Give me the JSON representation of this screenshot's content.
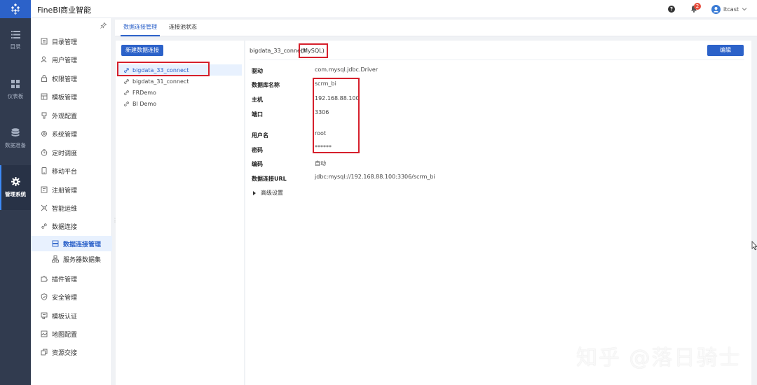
{
  "app": {
    "title": "FineBI商业智能"
  },
  "header": {
    "notification_count": "2",
    "username": "itcast"
  },
  "left_nav": [
    {
      "label": "目录",
      "icon": "list-icon"
    },
    {
      "label": "仪表板",
      "icon": "dashboard-icon"
    },
    {
      "label": "数据准备",
      "icon": "database-icon"
    },
    {
      "label": "管理系统",
      "icon": "gear-icon",
      "active": true
    }
  ],
  "menu": {
    "items": [
      {
        "label": "目录管理",
        "icon": "catalog-icon"
      },
      {
        "label": "用户管理",
        "icon": "user-icon"
      },
      {
        "label": "权限管理",
        "icon": "lock-icon"
      },
      {
        "label": "模板管理",
        "icon": "template-icon"
      },
      {
        "label": "外观配置",
        "icon": "appearance-icon"
      },
      {
        "label": "系统管理",
        "icon": "settings-icon"
      },
      {
        "label": "定时调度",
        "icon": "clock-icon"
      },
      {
        "label": "移动平台",
        "icon": "mobile-icon"
      },
      {
        "label": "注册管理",
        "icon": "register-icon"
      },
      {
        "label": "智能运维",
        "icon": "ops-icon"
      },
      {
        "label": "数据连接",
        "icon": "link-icon"
      },
      {
        "label": "数据连接管理",
        "icon": "connection-manage-icon",
        "sub": true,
        "active": true
      },
      {
        "label": "服务器数据集",
        "icon": "server-dataset-icon",
        "sub": true
      },
      {
        "label": "插件管理",
        "icon": "plugin-icon"
      },
      {
        "label": "安全管理",
        "icon": "shield-icon"
      },
      {
        "label": "模板认证",
        "icon": "certificate-icon"
      },
      {
        "label": "地图配置",
        "icon": "map-icon"
      },
      {
        "label": "资源交接",
        "icon": "handover-icon"
      }
    ]
  },
  "tabs": [
    {
      "label": "数据连接管理",
      "active": true
    },
    {
      "label": "连接池状态"
    }
  ],
  "connections": {
    "new_button": "新建数据连接",
    "items": [
      {
        "name": "bigdata_33_connect",
        "selected": true
      },
      {
        "name": "bigdata_31_connect"
      },
      {
        "name": "FRDemo"
      },
      {
        "name": "BI Demo"
      }
    ]
  },
  "detail": {
    "name": "bigdata_33_connect",
    "type": "(MySQL)",
    "edit_button": "编辑",
    "fields": [
      {
        "label": "驱动",
        "value": "com.mysql.jdbc.Driver"
      },
      {
        "label": "数据库名称",
        "value": "scrm_bi"
      },
      {
        "label": "主机",
        "value": "192.168.88.100"
      },
      {
        "label": "端口",
        "value": "3306"
      },
      {
        "label": "用户名",
        "value": "root"
      },
      {
        "label": "密码",
        "value": "******"
      },
      {
        "label": "编码",
        "value": "自动"
      },
      {
        "label": "数据连接URL",
        "value": "jdbc:mysql://192.168.88.100:3306/scrm_bi"
      }
    ],
    "advanced": "高级设置"
  },
  "watermark": "知乎 @落日骑士",
  "colors": {
    "accent": "#2c62c9",
    "nav_bg": "#313b4f",
    "highlight": "#d6202c"
  }
}
